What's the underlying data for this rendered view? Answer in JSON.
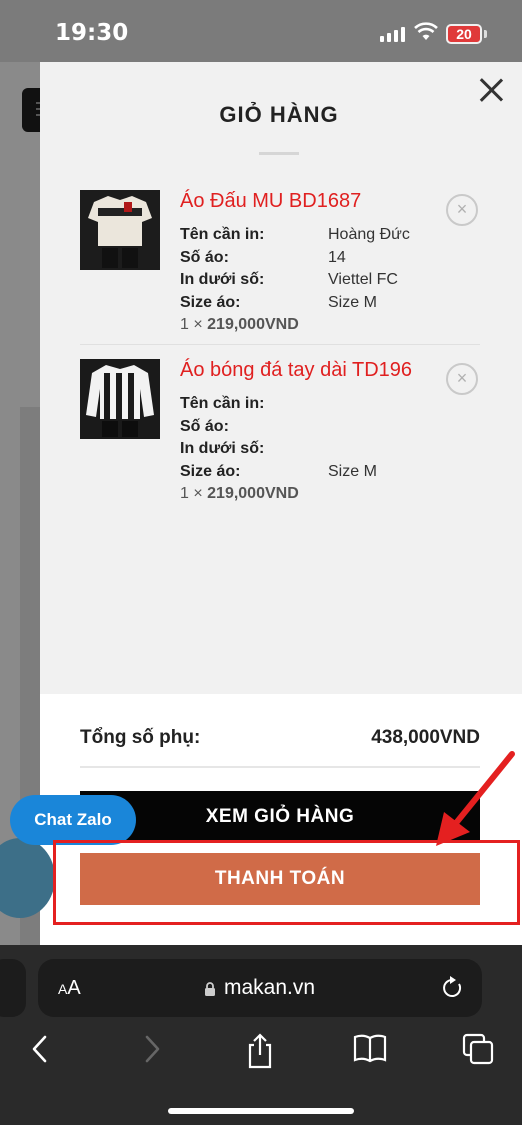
{
  "status": {
    "time": "19:30",
    "battery": "20"
  },
  "cart": {
    "title": "GIỎ HÀNG",
    "remove_symbol": "×",
    "attr_labels": {
      "name": "Tên cần in:",
      "number": "Số áo:",
      "below": "In dưới số:",
      "size": "Size áo:"
    },
    "items": [
      {
        "name": "Áo Đấu MU BD1687",
        "name_print": "Hoàng Đức",
        "number": "14",
        "below_number": "Viettel FC",
        "size": "Size M",
        "qty": "1",
        "price": "219,000VND"
      },
      {
        "name": "Áo bóng đá tay dài TD196",
        "name_print": "",
        "number": "",
        "below_number": "",
        "size": "Size M",
        "qty": "1",
        "price": "219,000VND"
      }
    ],
    "subtotal_label": "Tổng số phụ:",
    "subtotal_value": "438,000VND",
    "view_cart_label": "XEM GIỎ HÀNG",
    "checkout_label": "THANH TOÁN"
  },
  "chat": {
    "label": "Chat Zalo"
  },
  "browser": {
    "aa_small": "A",
    "aa_large": "A",
    "url": "makan.vn"
  },
  "icons": [
    "close-icon",
    "remove-icon",
    "lock-icon",
    "reload-icon",
    "back-icon",
    "forward-icon",
    "share-icon",
    "bookmarks-icon",
    "tabs-icon",
    "phone-icon",
    "wifi-icon",
    "signal-icon",
    "battery-icon"
  ],
  "colors": {
    "price_red": "#e02020",
    "checkout": "#d06b48",
    "highlight": "#e42020",
    "zalo_blue": "#1a86d9"
  }
}
